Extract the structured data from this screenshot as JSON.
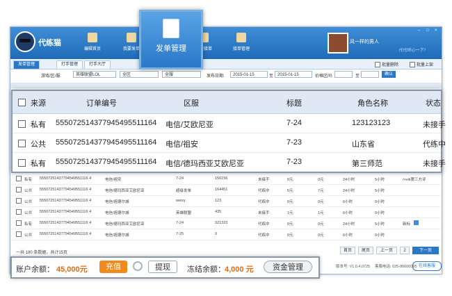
{
  "app": {
    "name": "代练猫",
    "slogan": "代代所心一下！",
    "user_name": "风一样的男人"
  },
  "nav": [
    {
      "label": "编辑首页"
    },
    {
      "label": "我要发单"
    },
    {
      "label": "发单管理"
    },
    {
      "label": "我要接单"
    },
    {
      "label": "接单管理"
    }
  ],
  "tabs": [
    {
      "label": "发单管理"
    },
    {
      "label": "打手管理"
    },
    {
      "label": "打手大厅"
    }
  ],
  "actions": {
    "batch_delete": "批量删除",
    "batch_shelf": "批量上架"
  },
  "filter": {
    "game_label": "游戏/区/服:",
    "game_value": "英雄联盟LOL",
    "region_value": "全区",
    "server_value": "全服",
    "date_label": "发布日期:",
    "date_from": "2015-01-15",
    "date_sep": "至",
    "date_to": "2015-01-15",
    "price_label": "价格区间:",
    "price_sep": "至",
    "confirm": "确认"
  },
  "zoom_table": {
    "headers": [
      "来源",
      "订单编号",
      "区服",
      "标题",
      "角色名称",
      "状态"
    ],
    "rows": [
      {
        "source": "私有",
        "order": "5550725143779454955111​64",
        "server": "电信/艾欧尼亚",
        "title": "7-24",
        "role": "123123123",
        "status": "未接手"
      },
      {
        "source": "公共",
        "order": "55507251437794549551116​4",
        "server": "电信/祖安",
        "title": "7-23",
        "role": "山东省",
        "status": "代练中"
      },
      {
        "source": "私有",
        "order": "5550725143779454955111​64",
        "server": "电信/德玛西亚艾欧尼亚",
        "title": "7-23",
        "role": "第三师范",
        "status": "未接手"
      }
    ]
  },
  "list_rows": [
    {
      "source": "私有",
      "order": "55507251437794549551116 4",
      "server": "电信/祖安",
      "title": "7-24",
      "role": "156156",
      "status": "未接手",
      "amt": "0元",
      "price": "0元",
      "t1": "24小时",
      "t2": "5小时",
      "note": "/+vik第三方评"
    },
    {
      "source": "公共",
      "order": "55507251437794549551116 4",
      "server": "电信/德玛西亚艾欧尼亚",
      "title": "超级发单",
      "role": "164451",
      "status": "代练中",
      "amt": "5元",
      "price": "7元",
      "t1": "24小时",
      "t2": "5小时",
      "note": ""
    },
    {
      "source": "公共",
      "order": "55507251437794549551116 4",
      "server": "电信/祖德尔城",
      "title": "weixy",
      "role": "123",
      "status": "代练中",
      "amt": "0元",
      "price": "0元",
      "t1": "6小时",
      "t2": "0小时",
      "note": ""
    },
    {
      "source": "公共",
      "order": "55507251437794549551116 4",
      "server": "电信/祖德尔城",
      "title": "英雄联盟",
      "role": "435",
      "status": "未接手",
      "amt": "1元",
      "price": "1元",
      "t1": "6小时",
      "t2": "0小时",
      "note": ""
    },
    {
      "source": "私有",
      "order": "55507251437794549551116 4",
      "server": "电信/德玛西亚艾欧尼亚",
      "title": "7-24",
      "role": "321323",
      "status": "代练中",
      "amt": "0元",
      "price": "0元",
      "t1": "24小时",
      "t2": "5小时",
      "note": "新标"
    },
    {
      "source": "公共",
      "order": "55507251437794549551116 4",
      "server": "电信/祖德尔城",
      "title": "7-25",
      "role": "0",
      "status": "代练中",
      "amt": "0元",
      "price": "0元",
      "t1": "6小时",
      "t2": "0小时",
      "note": ""
    }
  ],
  "footer": {
    "info": "一共 180 条数据，共计15页",
    "first": "首页",
    "prev_page": "尾页",
    "prev": "上一页",
    "page": "2",
    "next": "下一页",
    "version": "版本号: V1.0.4.0725",
    "hotline": "客服电话: 025-86600095",
    "service": "在线客服"
  },
  "account": {
    "balance_label": "账户余额：",
    "balance_value": "45,000元",
    "recharge": "充值",
    "withdraw": "提现",
    "frozen_label": "冻结余额：",
    "frozen_value": "4,000 元",
    "fund_manage": "资金管理"
  }
}
